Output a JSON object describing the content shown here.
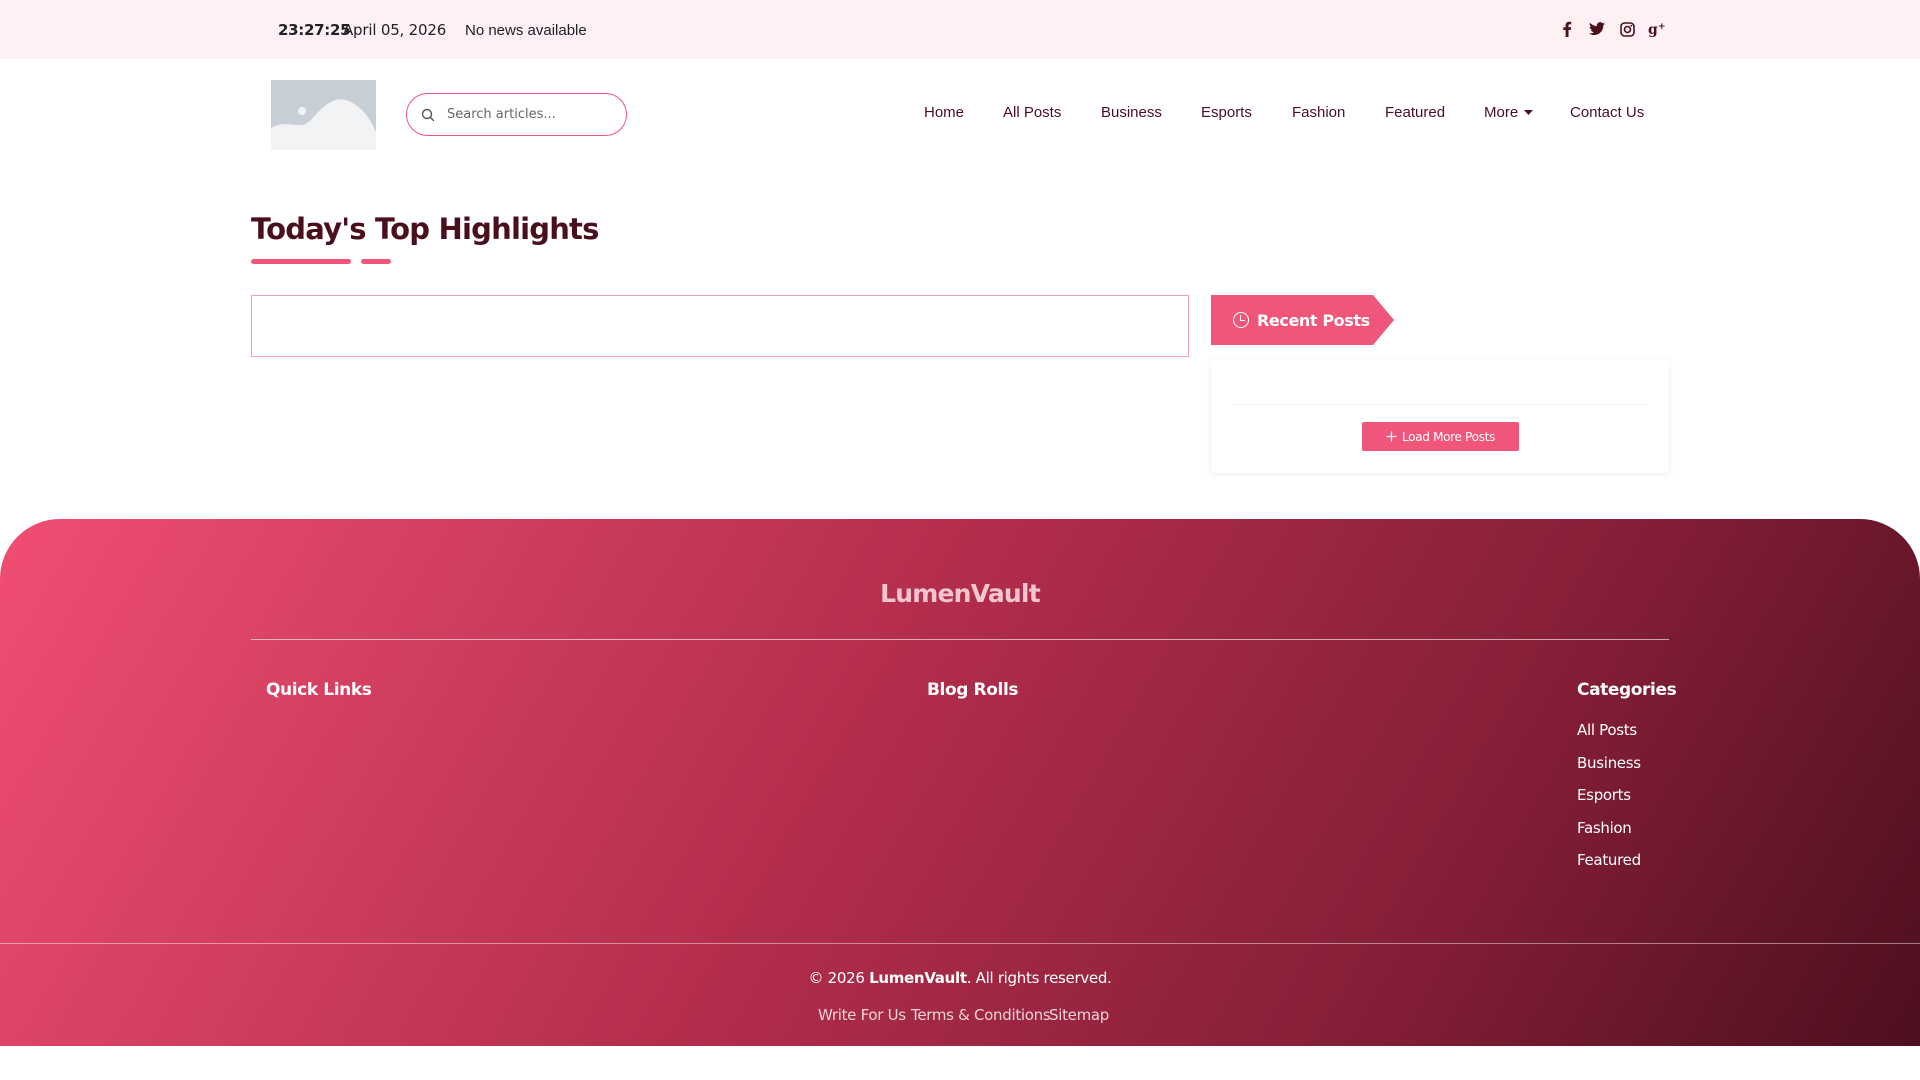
{
  "topbar": {
    "time": "23:27:25",
    "date": "April 05, 2026",
    "news": "No news available",
    "social": [
      {
        "icon": "facebook-icon",
        "glyph": "f"
      },
      {
        "icon": "twitter-icon",
        "glyph": "t"
      },
      {
        "icon": "instagram-icon",
        "glyph": "o"
      },
      {
        "icon": "google-plus-icon",
        "glyph": "g+"
      }
    ]
  },
  "header": {
    "search_placeholder": "Search articles...",
    "nav": [
      "Home",
      "All Posts",
      "Business",
      "Esports",
      "Fashion",
      "Featured",
      "More",
      "Contact Us"
    ]
  },
  "main": {
    "title": "Today's Top Highlights"
  },
  "sidebar": {
    "recent_title": "Recent Posts",
    "load_more_label": "Load More Posts"
  },
  "footer": {
    "brand": "LumenVault",
    "quick_links_title": "Quick Links",
    "blog_rolls_title": "Blog Rolls",
    "categories_title": "Categories",
    "categories": [
      "All Posts",
      "Business",
      "Esports",
      "Fashion",
      "Featured"
    ],
    "copyright_prefix": "© 2026",
    "copyright_brand": "LumenVault",
    "copyright_suffix": ". All rights reserved.",
    "links": [
      "Write For Us",
      "Terms & Conditions",
      "Sitemap"
    ]
  },
  "colors": {
    "accent": "#f0557a",
    "dark": "#4a0f1c",
    "topbar_bg": "#fff0f3"
  }
}
